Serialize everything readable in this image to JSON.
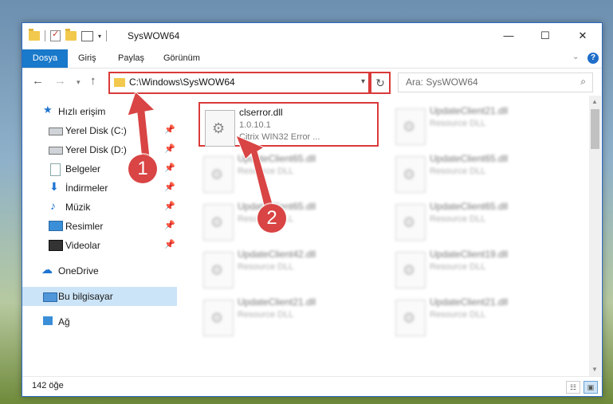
{
  "window": {
    "title": "SysWOW64",
    "buttons": {
      "minimize": "—",
      "maximize": "☐",
      "close": "✕"
    }
  },
  "ribbon": {
    "tabs": [
      "Dosya",
      "Giriş",
      "Paylaş",
      "Görünüm"
    ],
    "collapse_icon": "chevron-down-icon",
    "help_label": "?"
  },
  "navigation": {
    "back": "←",
    "forward": "→",
    "recent": "▾",
    "up": "↑",
    "address": "C:\\Windows\\SysWOW64",
    "address_chevron": "▾",
    "refresh": "↻",
    "search_placeholder": "Ara: SysWOW64",
    "search_icon": "⌕"
  },
  "sidebar": {
    "items": [
      {
        "label": "Hızlı erişim",
        "icon": "★"
      },
      {
        "label": "Yerel Disk (C:)",
        "pinned": true
      },
      {
        "label": "Yerel Disk (D:)",
        "pinned": true
      },
      {
        "label": "Belgeler",
        "pinned": true
      },
      {
        "label": "İndirmeler",
        "icon": "⬇",
        "pinned": true
      },
      {
        "label": "Müzik",
        "icon": "♪",
        "pinned": true
      },
      {
        "label": "Resimler",
        "pinned": true
      },
      {
        "label": "Videolar",
        "pinned": true
      },
      {
        "label": "OneDrive",
        "icon": "☁"
      },
      {
        "label": "Bu bilgisayar",
        "selected": true
      },
      {
        "label": "Ağ"
      }
    ],
    "pin_glyph": "📌"
  },
  "files": {
    "highlighted": {
      "name": "clserror.dll",
      "version": "1.0.10.1",
      "description": "Citrix WIN32 Error ..."
    },
    "items": [
      {
        "name": "UpdateClient21.dll",
        "type": "Resource DLL"
      },
      {
        "name": "UpdateClient65.dll",
        "type": "Resource DLL"
      },
      {
        "name": "UpdateClient65.dll",
        "type": "Resource DLL"
      },
      {
        "name": "UpdateClient65.dll",
        "type": "Resource DLL"
      },
      {
        "name": "UpdateClient65.dll",
        "type": "Resource DLL"
      },
      {
        "name": "UpdateClient42.dll",
        "type": "Resource DLL"
      },
      {
        "name": "UpdateClient19.dll",
        "type": "Resource DLL"
      },
      {
        "name": "UpdateClient21.dll",
        "type": "Resource DLL"
      },
      {
        "name": "UpdateClient21.dll",
        "type": "Resource DLL"
      }
    ],
    "gear_glyph": "⚙"
  },
  "status": {
    "count": "142 öğe"
  },
  "annotations": {
    "callout_1": "1",
    "callout_2": "2",
    "color": "#d93a3a"
  },
  "colors": {
    "accent": "#1979ca",
    "selection": "#cce4f7"
  }
}
